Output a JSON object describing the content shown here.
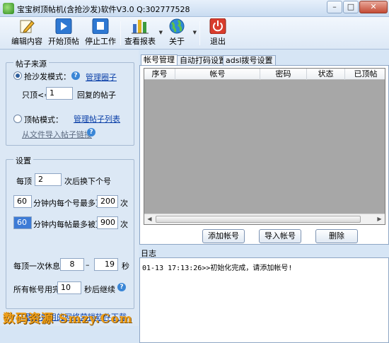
{
  "window": {
    "title": "宝宝树顶帖机(含抢沙发)软件V3.0 Q:302777528",
    "minimize": "–",
    "maximize": "□",
    "close": "✕"
  },
  "toolbar": {
    "edit": "编辑内容",
    "start": "开始顶帖",
    "stop": "停止工作",
    "report": "查看报表",
    "about": "关于",
    "exit": "退出"
  },
  "source_group": {
    "title": "帖子来源",
    "sofa_mode_label": "抢沙发模式：",
    "manage_circle_link": "管理圈子",
    "only_top_prefix": "只顶<=",
    "only_top_value": "1",
    "only_top_suffix": "回复的帖子",
    "top_mode_label": "顶帖模式：",
    "manage_list_link": "管理帖子列表",
    "import_link": "从文件导入帖子链接"
  },
  "settings_group": {
    "title": "设置",
    "every_top_prefix": "每顶",
    "every_top_value": "2",
    "every_top_suffix": "次后换下个号",
    "minutes_1": "60",
    "per_account_label": "分钟内每个号最多顶",
    "per_account_max": "200",
    "times_1": "次",
    "minutes_2": "60",
    "per_post_label": "分钟内每帖最多被顶",
    "per_post_max": "900",
    "times_2": "次",
    "rest_label": "每顶一次休息",
    "rest_min": "8",
    "rest_dash": "–",
    "rest_max": "19",
    "rest_unit": "秒",
    "all_used_label": "所有帐号用完",
    "all_used_value": "10",
    "all_used_suffix": "秒后继续"
  },
  "tabs": [
    "帐号管理",
    "自动打码设置",
    "adsl拨号设置"
  ],
  "accounts_table": {
    "columns": [
      "序号",
      "帐号",
      "密码",
      "状态",
      "已顶帖"
    ],
    "rows": []
  },
  "account_buttons": {
    "add": "添加帐号",
    "import": "导入帐号",
    "delete": "删除"
  },
  "log": {
    "title": "日志",
    "lines": [
      "01-13 17:13:26>>初始化完成，请添加帐号!"
    ]
  },
  "footer": {
    "watermark": "数码资源 Smzy.Com",
    "link": "更多好用的网络营销软件下载"
  }
}
